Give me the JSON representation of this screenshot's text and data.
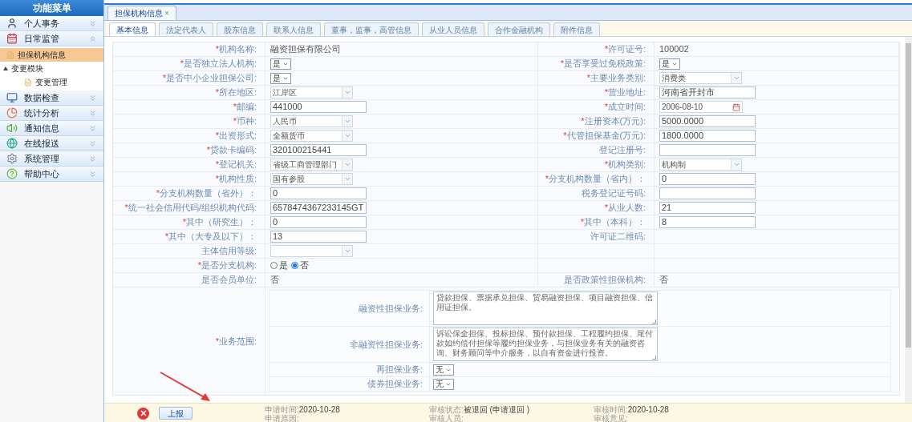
{
  "sidebar": {
    "title": "功能菜单",
    "sections": [
      {
        "label": "个人事务",
        "expanded": false
      },
      {
        "label": "日常监管",
        "expanded": true,
        "items": [
          {
            "label": "担保机构信息",
            "selected": true
          },
          {
            "label": "变更模块",
            "expanded": true,
            "children": [
              {
                "label": "变更管理",
                "selected": false
              }
            ]
          }
        ]
      },
      {
        "label": "数据检查",
        "expanded": false
      },
      {
        "label": "统计分析",
        "expanded": false
      },
      {
        "label": "通知信息",
        "expanded": false
      },
      {
        "label": "在线报送",
        "expanded": false
      },
      {
        "label": "系统管理",
        "expanded": false
      },
      {
        "label": "帮助中心",
        "expanded": false
      }
    ]
  },
  "page_tabs": [
    {
      "label": "担保机构信息",
      "close": "×",
      "selected": true
    }
  ],
  "tabs": [
    {
      "label": "基本信息",
      "selected": true
    },
    {
      "label": "法定代表人",
      "selected": false
    },
    {
      "label": "股东信息",
      "selected": false
    },
    {
      "label": "联系人信息",
      "selected": false
    },
    {
      "label": "董事，监事，高管信息",
      "selected": false
    },
    {
      "label": "从业人员信息",
      "selected": false
    },
    {
      "label": "合作金融机构",
      "selected": false
    },
    {
      "label": "附件信息",
      "selected": false
    }
  ],
  "form": {
    "rows": [
      [
        {
          "mark": "*",
          "label": "机构名称:",
          "kind": "text",
          "value": "融资担保有限公司"
        },
        {
          "mark": "*",
          "label": "许可证号:",
          "kind": "text",
          "value": "100002"
        }
      ],
      [
        {
          "mark": "*",
          "label": "是否独立法人机构:",
          "kind": "small_select",
          "value": "是"
        },
        {
          "mark": "*",
          "label": "是否享受过免税政策:",
          "kind": "small_select",
          "value": "是"
        }
      ],
      [
        {
          "mark": "*",
          "label": "是否中小企业担保公司:",
          "kind": "small_select",
          "value": "是"
        },
        {
          "mark": "*",
          "label": "主要业务类别:",
          "kind": "select",
          "value": "消费类"
        }
      ],
      [
        {
          "mark": "*",
          "label": "所在地区:",
          "kind": "select",
          "value": "江岸区"
        },
        {
          "mark": "*",
          "label": "营业地址:",
          "kind": "input",
          "value": "河南省开封市"
        }
      ],
      [
        {
          "mark": "*",
          "label": "邮编:",
          "kind": "input",
          "value": "441000"
        },
        {
          "mark": "*",
          "label": "成立时间:",
          "kind": "date",
          "value": "2006-08-10"
        }
      ],
      [
        {
          "mark": "*",
          "label": "币种:",
          "kind": "select",
          "value": "人民币"
        },
        {
          "mark": "*",
          "label": "注册资本(万元):",
          "kind": "input",
          "value": "5000.0000"
        }
      ],
      [
        {
          "mark": "*",
          "label": "出资形式:",
          "kind": "select",
          "value": "全额货币"
        },
        {
          "mark": "*",
          "label": "代管担保基金(万元):",
          "kind": "input",
          "value": "1800.0000"
        }
      ],
      [
        {
          "mark": "*",
          "label": "贷款卡编码:",
          "kind": "input",
          "value": "320100215441"
        },
        {
          "label": "登记注册号:",
          "kind": "input"
        }
      ],
      [
        {
          "mark": "*",
          "label": "登记机关:",
          "kind": "select",
          "value": "省级工商管理部门"
        },
        {
          "mark": "*",
          "label": "机构类别:",
          "kind": "select",
          "value": "机构制"
        }
      ],
      [
        {
          "mark": "*",
          "label": "机构性质:",
          "kind": "select",
          "value": "国有参股"
        },
        {
          "mark": "*",
          "label": "分支机构数量（省内）：",
          "kind": "input",
          "value": "0"
        }
      ],
      [
        {
          "mark": "*",
          "label": "分支机构数量（省外）：",
          "kind": "input",
          "value": "0"
        },
        {
          "label": "税务登记证号码:",
          "kind": "input"
        }
      ],
      [
        {
          "mark": "*",
          "label": "统一社会信用代码/组织机构代码:",
          "kind": "input",
          "value": "6578474367233145GT"
        },
        {
          "mark": "*",
          "label": "从业人数:",
          "kind": "input",
          "value": "21"
        }
      ],
      [
        {
          "mark": "*",
          "label": "其中（研究生）：",
          "kind": "input",
          "value": "0"
        },
        {
          "mark": "*",
          "label": "其中（本科）：",
          "kind": "input",
          "value": "8"
        }
      ],
      [
        {
          "mark": "*",
          "label": "其中（大专及以下）：",
          "kind": "input",
          "value": "13"
        },
        {
          "label": "许可证二维码:"
        }
      ],
      [
        {
          "label": "主体信用等级:",
          "kind": "select"
        }
      ],
      [
        {
          "mark": "*",
          "label": "是否分支机构:",
          "kind": "radio",
          "options": [
            {
              "label": "是",
              "selected": false
            },
            {
              "label": "否",
              "selected": true
            }
          ]
        }
      ],
      [
        {
          "label": "是否会员单位:",
          "kind": "text",
          "value": "否"
        },
        {
          "label": "是否政策性担保机构:",
          "kind": "text",
          "value": "否"
        }
      ]
    ],
    "scope": {
      "mark": "*",
      "label": "业务范围:",
      "items": [
        {
          "label": "融资性担保业务:",
          "kind": "textarea",
          "value": "贷款担保、票据承兑担保、贸易融资担保、项目融资担保、信用证担保。"
        },
        {
          "label": "非融资性担保业务:",
          "kind": "textarea",
          "value": "诉讼保全担保、投标担保、预付款担保、工程履约担保、尾付款如约偿付担保等履约担保业务，与担保业务有关的融资咨询、财务顾问等中介服务，以自有资金进行投资。"
        },
        {
          "label": "再担保业务:",
          "kind": "small_select",
          "value": "无"
        },
        {
          "label": "债券担保业务:",
          "kind": "small_select",
          "value": "无"
        }
      ]
    }
  },
  "footer": {
    "button": "上报",
    "columns": [
      [
        {
          "label": "申请时间:",
          "value": "2020-10-28"
        },
        {
          "label": "申请原因:"
        }
      ],
      [
        {
          "label": "审核状态:",
          "value": "被退回 (申请退回 )"
        },
        {
          "label": "审核人员:"
        }
      ],
      [
        {
          "label": "审核时间:",
          "value": "2020-10-28"
        },
        {
          "label": "审核意见:"
        }
      ]
    ]
  }
}
